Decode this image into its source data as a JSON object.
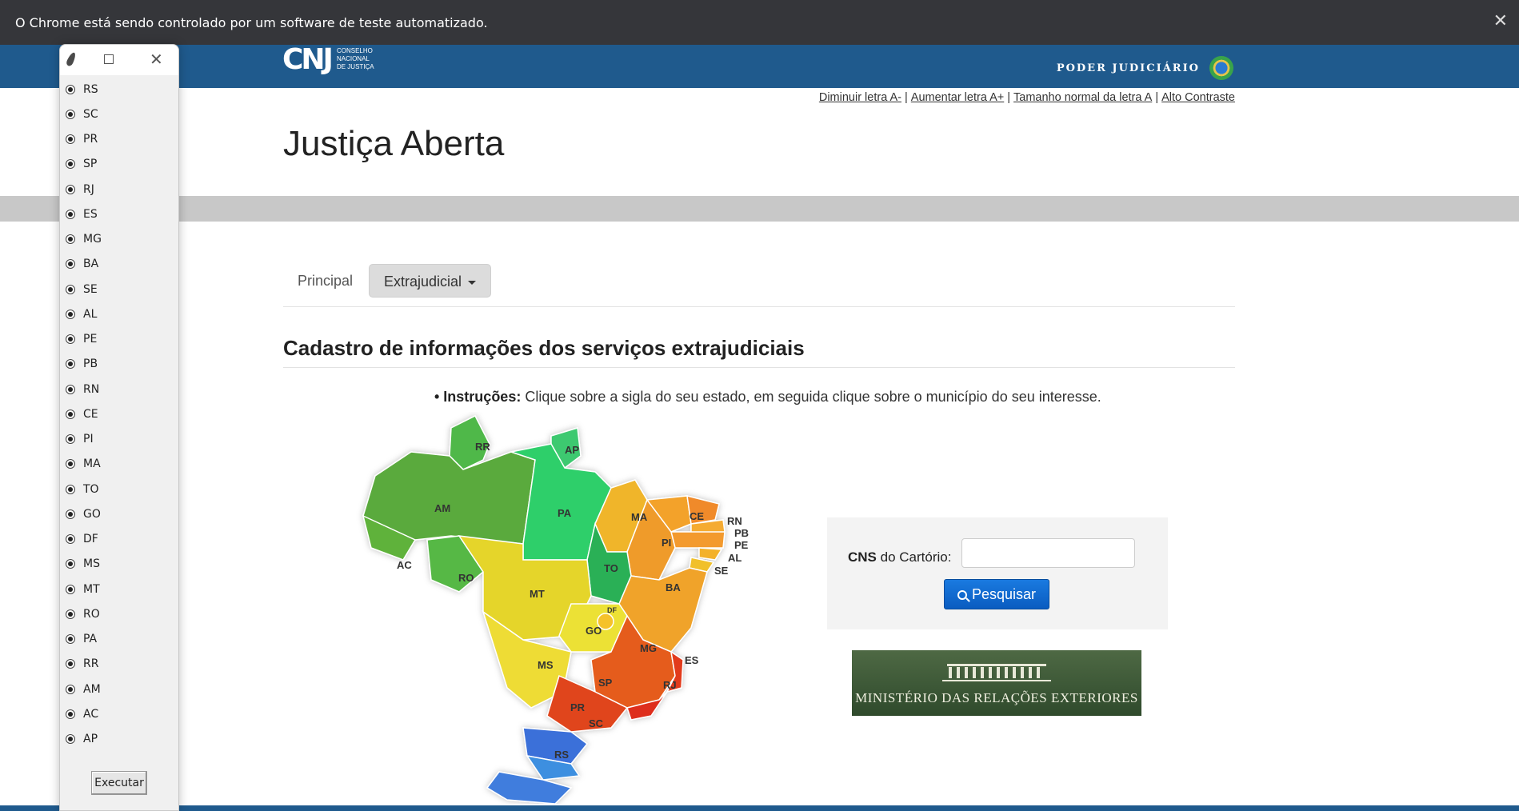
{
  "infobar": {
    "message": "O Chrome está sendo controlado por um software de teste automatizado.",
    "close_glyph": "✕"
  },
  "header": {
    "logo_mark": "CNJ",
    "logo_org_lines": [
      "CONSELHO",
      "NACIONAL",
      "DE JUSTIÇA"
    ],
    "poder": "PODER JUDICIÁRIO",
    "brand_color": "#1f5a8d"
  },
  "accessibility": {
    "links": [
      "Diminuir letra A-",
      "Aumentar letra A+",
      "Tamanho normal da letra A",
      "Alto Contraste"
    ],
    "sep": "|"
  },
  "page": {
    "title": "Justiça Aberta"
  },
  "nav": {
    "principal": "Principal",
    "extrajudicial": "Extrajudicial"
  },
  "section": {
    "title": "Cadastro de informações dos serviços extrajudiciais",
    "instr_bold": "• Instruções:",
    "instr_text": " Clique sobre a sigla do seu estado, em seguida clique sobre o município do seu interesse."
  },
  "map": {
    "states": [
      "RR",
      "AP",
      "AM",
      "PA",
      "MA",
      "CE",
      "RN",
      "PB",
      "PE",
      "AL",
      "SE",
      "PI",
      "AC",
      "RO",
      "TO",
      "BA",
      "MT",
      "DF",
      "GO",
      "MG",
      "ES",
      "MS",
      "SP",
      "RJ",
      "PR",
      "SC",
      "RS"
    ]
  },
  "form": {
    "cns_bold": "CNS",
    "cns_rest": " do Cartório:",
    "input_value": "",
    "button": "Pesquisar",
    "button_icon": "search-icon"
  },
  "banner": {
    "text": "MINISTÉRIO DAS RELAÇÕES EXTERIORES"
  },
  "tk": {
    "options": [
      "RS",
      "SC",
      "PR",
      "SP",
      "RJ",
      "ES",
      "MG",
      "BA",
      "SE",
      "AL",
      "PE",
      "PB",
      "RN",
      "CE",
      "PI",
      "MA",
      "TO",
      "GO",
      "DF",
      "MS",
      "MT",
      "RO",
      "PA",
      "RR",
      "AM",
      "AC",
      "AP"
    ],
    "execute": "Executar",
    "close_glyph": "✕"
  }
}
